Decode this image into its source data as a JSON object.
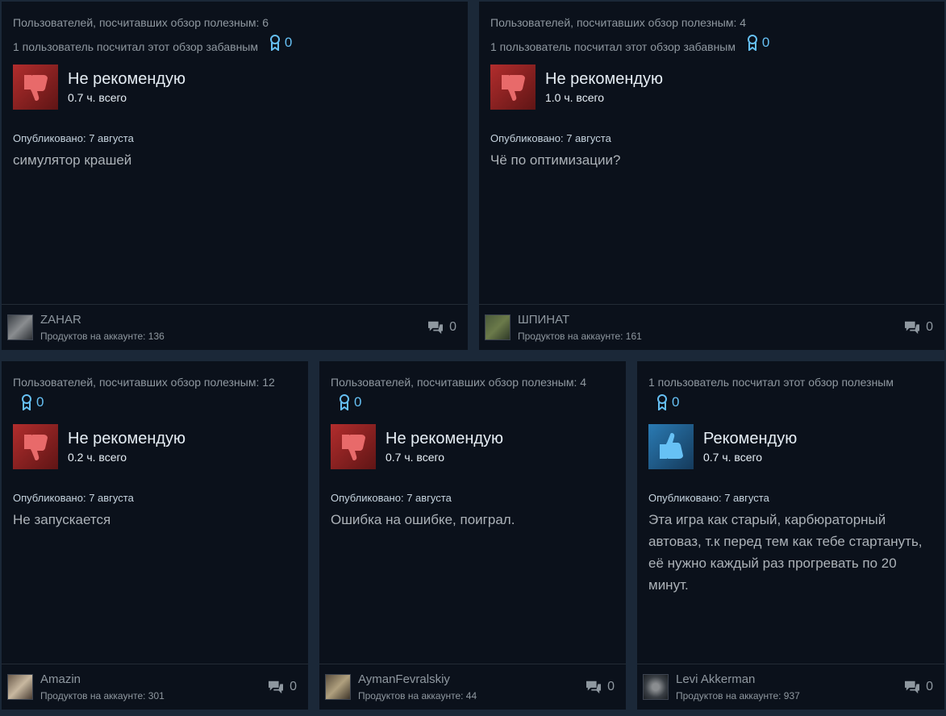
{
  "reviews": [
    {
      "helpful": "Пользователей, посчитавших обзор полезным: 6",
      "funny": "1 пользователь посчитал этот обзор забавным",
      "awards": "0",
      "verdict": "Не рекомендую",
      "hours": "0.7 ч. всего",
      "posted": "Опубликовано: 7 августа",
      "text": "симулятор крашей",
      "user": "ZAHAR",
      "products": "Продуктов на аккаунте: 136",
      "comments": "0",
      "thumb": "thumbs-down-icon"
    },
    {
      "helpful": "Пользователей, посчитавших обзор полезным: 4",
      "funny": "1 пользователь посчитал этот обзор забавным",
      "awards": "0",
      "verdict": "Не рекомендую",
      "hours": "1.0 ч. всего",
      "posted": "Опубликовано: 7 августа",
      "text": "Чё по оптимизации?",
      "user": "ШПИНАТ",
      "products": "Продуктов на аккаунте: 161",
      "comments": "0",
      "thumb": "thumbs-down-icon"
    },
    {
      "helpful": "Пользователей, посчитавших обзор полезным: 12",
      "awards": "0",
      "verdict": "Не рекомендую",
      "hours": "0.2 ч. всего",
      "posted": "Опубликовано: 7 августа",
      "text": "Не запускается",
      "user": "Amazin",
      "products": "Продуктов на аккаунте: 301",
      "comments": "0",
      "thumb": "thumbs-down-icon"
    },
    {
      "helpful": "Пользователей, посчитавших обзор полезным: 4",
      "awards": "0",
      "verdict": "Не рекомендую",
      "hours": "0.7 ч. всего",
      "posted": "Опубликовано: 7 августа",
      "text": "Ошибка на ошибке, поиграл.",
      "user": "AymanFevralskiy",
      "products": "Продуктов на аккаунте: 44",
      "comments": "0",
      "thumb": "thumbs-down-icon"
    },
    {
      "helpful": "1 пользователь посчитал этот обзор полезным",
      "awards": "0",
      "verdict": "Рекомендую",
      "hours": "0.7 ч. всего",
      "posted": "Опубликовано: 7 августа",
      "text": "Эта игра как старый, карбюраторный автоваз, т.к перед тем как тебе стартануть, её нужно каждый раз прогревать по 20 минут.",
      "user": "Levi Akkerman",
      "products": "Продуктов на аккаунте: 937",
      "comments": "0",
      "thumb": "thumbs-up-icon"
    }
  ],
  "colors": {
    "background": "#1b2838",
    "card": "#0b111b",
    "accent": "#66c0f4",
    "negative": "#b22d2d",
    "positive": "#2a7bb4"
  }
}
